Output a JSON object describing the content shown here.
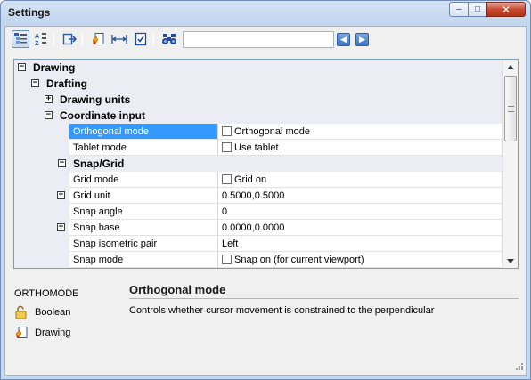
{
  "window": {
    "title": "Settings"
  },
  "titlebar": {
    "minimize": "–",
    "maximize": "□",
    "close": "✕"
  },
  "toolbar": {
    "search_value": "",
    "icons": [
      "categorized-view-icon",
      "alphabetic-sort-icon",
      "export-icon",
      "import-drawing-icon",
      "dimension-icon",
      "checklist-icon",
      "find-binoculars-icon"
    ],
    "prev_arrow": "◀",
    "next_arrow": "▶"
  },
  "tree": {
    "drawing": "Drawing",
    "drafting": "Drafting",
    "drawing_units": "Drawing units",
    "coordinate_input": "Coordinate input",
    "snap_grid": "Snap/Grid",
    "expand_minus": "−",
    "expand_plus": "+",
    "rows": [
      {
        "name": "Orthogonal mode",
        "value": "Orthogonal mode",
        "checkbox": true,
        "checked": false,
        "selected": true
      },
      {
        "name": "Tablet mode",
        "value": "Use tablet",
        "checkbox": true,
        "checked": false
      }
    ],
    "snap_rows": [
      {
        "name": "Grid mode",
        "value": "Grid on",
        "checkbox": true,
        "checked": false,
        "expandable": false
      },
      {
        "name": "Grid unit",
        "value": "0.5000,0.5000",
        "checkbox": false,
        "expandable": true
      },
      {
        "name": "Snap angle",
        "value": "0",
        "checkbox": false,
        "expandable": false
      },
      {
        "name": "Snap base",
        "value": "0.0000,0.0000",
        "checkbox": false,
        "expandable": true
      },
      {
        "name": "Snap isometric pair",
        "value": "Left",
        "checkbox": false,
        "expandable": false
      },
      {
        "name": "Snap mode",
        "value": "Snap on (for current viewport)",
        "checkbox": true,
        "checked": false,
        "expandable": false
      }
    ]
  },
  "info": {
    "variable_name": "ORTHOMODE",
    "type_label": "Boolean",
    "scope_label": "Drawing",
    "title": "Orthogonal mode",
    "description": "Controls whether cursor movement is constrained to the perpendicular"
  },
  "colors": {
    "selection": "#3399ff",
    "category_bg": "#ececf5",
    "nav_button": "#3e73c8",
    "close_button": "#c74a2f"
  }
}
